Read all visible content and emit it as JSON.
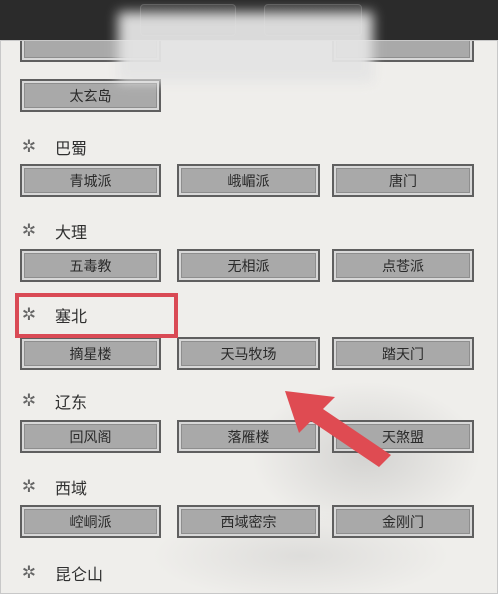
{
  "regions": [
    {
      "name": "巴蜀",
      "sects": [
        "青城派",
        "峨嵋派",
        "唐门"
      ]
    },
    {
      "name": "大理",
      "sects": [
        "五毒教",
        "无相派",
        "点苍派"
      ]
    },
    {
      "name": "塞北",
      "sects": [
        "摘星楼",
        "天马牧场",
        "踏天门"
      ]
    },
    {
      "name": "辽东",
      "sects": [
        "回风阁",
        "落雁楼",
        "天煞盟"
      ]
    },
    {
      "name": "西域",
      "sects": [
        "崆峒派",
        "西域密宗",
        "金刚门"
      ]
    },
    {
      "name": "昆仑山",
      "sects": []
    }
  ],
  "top_partial": {
    "sects": [
      "太玄岛"
    ]
  },
  "highlighted_region": "塞北",
  "arrow_target": "天马牧场",
  "colors": {
    "highlight": "#d94a55",
    "arrow": "#df4b52"
  },
  "icons": {
    "region_marker": "gear-icon",
    "pointer": "arrow-icon"
  }
}
